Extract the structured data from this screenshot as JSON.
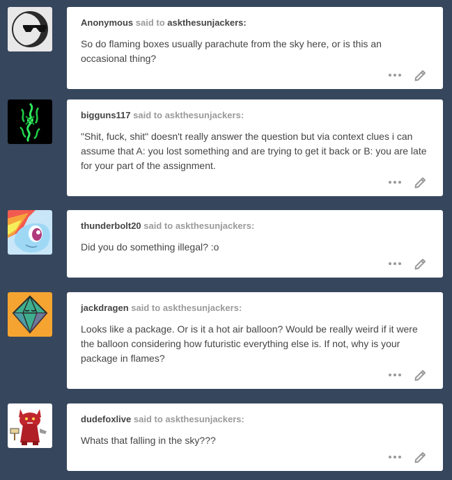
{
  "posts": [
    {
      "asker": "Anonymous",
      "said_to": "said to",
      "target": "askthesunjackers",
      "colon": ":",
      "body": "So do flaming boxes usually parachute from the sky here, or is this an occasional thing?",
      "avatar_icon": "sunglasses-moon-icon"
    },
    {
      "asker": "bigguns117",
      "said_to": "said to",
      "target": "askthesunjackers",
      "colon": ":",
      "body": "\"Shit, fuck, shit\" doesn't really answer the question but via context clues i can assume that A: you lost something and are trying to get it back or B: you are late for your part of the assignment.",
      "avatar_icon": "green-snake-logo-icon"
    },
    {
      "asker": "thunderbolt20",
      "said_to": "said to",
      "target": "askthesunjackers",
      "colon": ":",
      "body": "Did you do something illegal? :o",
      "avatar_icon": "rainbow-pony-icon"
    },
    {
      "asker": "jackdragen",
      "said_to": "said to",
      "target": "askthesunjackers",
      "colon": ":",
      "body": "Looks like a package. Or is it a hot air balloon? Would be really weird if it were the balloon considering how futuristic everything else is. If not, why is your package in flames?",
      "avatar_icon": "diamond-face-icon"
    },
    {
      "asker": "dudefoxlive",
      "said_to": "said to",
      "target": "askthesunjackers",
      "colon": ":",
      "body": "Whats that falling in the sky???",
      "avatar_icon": "red-fox-character-icon"
    }
  ],
  "colors": {
    "background": "#36465d",
    "card": "#ffffff",
    "text": "#444444",
    "muted": "#9a9a9a"
  }
}
